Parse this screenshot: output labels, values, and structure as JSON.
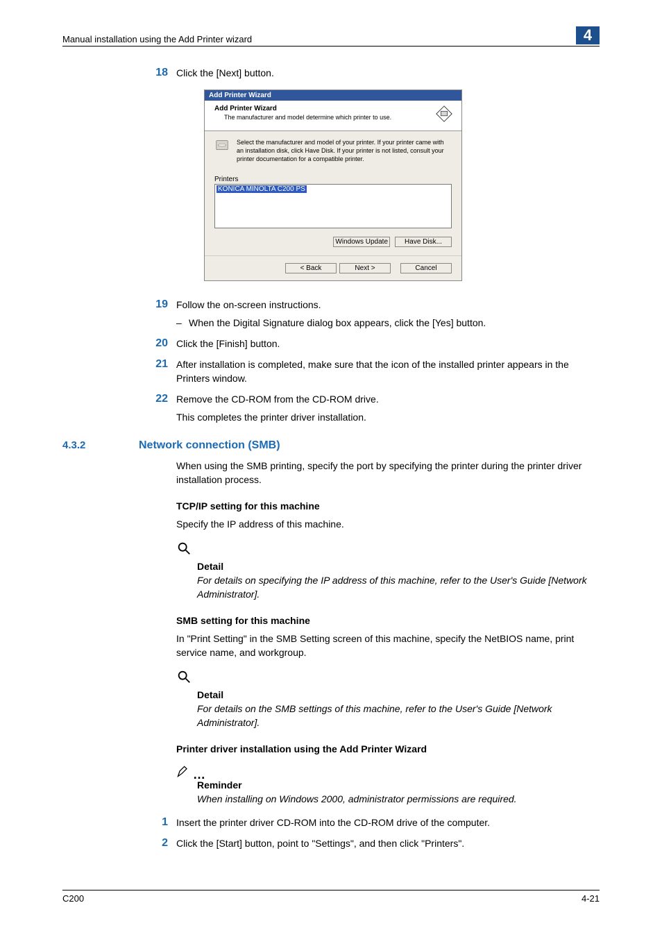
{
  "header": {
    "title": "Manual installation using the Add Printer wizard",
    "chapter": "4"
  },
  "steps_a": {
    "s18_num": "18",
    "s18": "Click the [Next] button.",
    "s19_num": "19",
    "s19": "Follow the on-screen instructions.",
    "s19_sub": "When the Digital Signature dialog box appears, click the [Yes] button.",
    "s20_num": "20",
    "s20": "Click the [Finish] button.",
    "s21_num": "21",
    "s21": "After installation is completed, make sure that the icon of the installed printer appears in the Printers window.",
    "s22_num": "22",
    "s22": "Remove the CD-ROM from the CD-ROM drive.",
    "done": "This completes the printer driver installation."
  },
  "wizard": {
    "titlebar": "Add Printer Wizard",
    "header_main": "Add Printer Wizard",
    "header_sub": "The manufacturer and model determine which printer to use.",
    "instr": "Select the manufacturer and model of your printer. If your printer came with an installation disk, click Have Disk. If your printer is not listed, consult your printer documentation for a compatible printer.",
    "printers_label": "Printers",
    "selected": "KONICA MINOLTA C200 PS",
    "windows_update": "Windows Update",
    "have_disk": "Have Disk...",
    "back": "< Back",
    "next": "Next >",
    "cancel": "Cancel"
  },
  "section": {
    "num": "4.3.2",
    "title": "Network connection (SMB)"
  },
  "sect_body": {
    "intro": "When using the SMB printing, specify the port by specifying the printer during the printer driver installation process.",
    "h_tcpip": "TCP/IP setting for this machine",
    "tcpip_body": "Specify the IP address of this machine.",
    "detail_label": "Detail",
    "tcpip_detail": "For details on specifying the IP address of this machine, refer to the User's Guide [Network Administrator].",
    "h_smb": "SMB setting for this machine",
    "smb_body": "In \"Print Setting\" in the SMB Setting screen of this machine, specify the NetBIOS name, print service name, and workgroup.",
    "smb_detail": "For details on the SMB settings of this machine, refer to the User's Guide [Network Administrator].",
    "h_install": "Printer driver installation using the Add Printer Wizard",
    "reminder_label": "Reminder",
    "reminder_body": "When installing on Windows 2000, administrator permissions are required."
  },
  "steps_b": {
    "s1_num": "1",
    "s1": "Insert the printer driver CD-ROM into the CD-ROM drive of the computer.",
    "s2_num": "2",
    "s2": "Click the [Start] button, point to \"Settings\", and then click \"Printers\"."
  },
  "footer": {
    "left": "C200",
    "right": "4-21"
  }
}
